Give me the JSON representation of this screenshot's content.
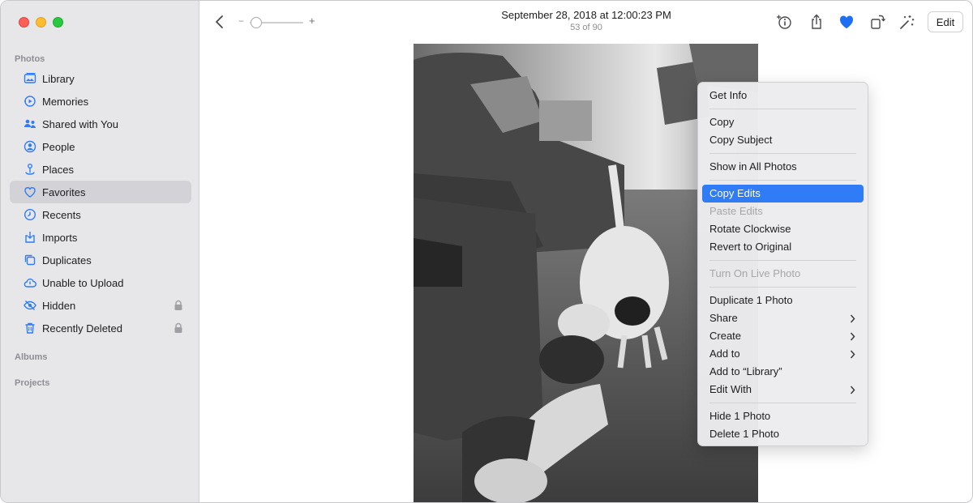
{
  "toolbar": {
    "date": "September 28, 2018 at 12:00:23 PM",
    "count": "53 of 90",
    "zoom_minus": "−",
    "zoom_plus": "+",
    "edit_label": "Edit",
    "favorite_color": "#1f6ff2"
  },
  "sidebar": {
    "photos_section": "Photos",
    "albums_section": "Albums",
    "projects_section": "Projects",
    "items": [
      {
        "label": "Library",
        "icon": "library-icon"
      },
      {
        "label": "Memories",
        "icon": "memories-icon"
      },
      {
        "label": "Shared with You",
        "icon": "shared-with-you-icon"
      },
      {
        "label": "People",
        "icon": "people-icon"
      },
      {
        "label": "Places",
        "icon": "places-icon"
      },
      {
        "label": "Favorites",
        "icon": "heart-icon",
        "selected": true
      },
      {
        "label": "Recents",
        "icon": "clock-icon"
      },
      {
        "label": "Imports",
        "icon": "imports-icon"
      },
      {
        "label": "Duplicates",
        "icon": "duplicates-icon"
      },
      {
        "label": "Unable to Upload",
        "icon": "cloud-icon"
      },
      {
        "label": "Hidden",
        "icon": "eye-slash-icon",
        "locked": true
      },
      {
        "label": "Recently Deleted",
        "icon": "trash-icon",
        "locked": true
      }
    ]
  },
  "menu": {
    "items": [
      {
        "label": "Get Info"
      },
      {
        "label": "Copy"
      },
      {
        "label": "Copy Subject"
      },
      {
        "label": "Show in All Photos"
      },
      {
        "label": "Copy Edits",
        "highlighted": true
      },
      {
        "label": "Paste Edits",
        "disabled": true
      },
      {
        "label": "Rotate Clockwise"
      },
      {
        "label": "Revert to Original"
      },
      {
        "label": "Turn On Live Photo",
        "disabled": true
      },
      {
        "label": "Duplicate 1 Photo"
      },
      {
        "label": "Share",
        "submenu": true
      },
      {
        "label": "Create",
        "submenu": true
      },
      {
        "label": "Add to",
        "submenu": true
      },
      {
        "label": "Add to “Library”"
      },
      {
        "label": "Edit With",
        "submenu": true
      },
      {
        "label": "Hide 1 Photo"
      },
      {
        "label": "Delete 1 Photo"
      }
    ]
  }
}
